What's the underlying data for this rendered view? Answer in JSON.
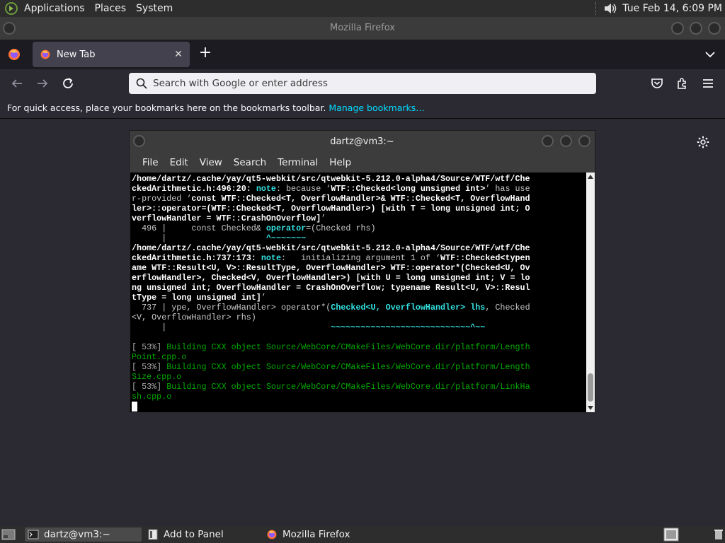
{
  "top_panel": {
    "menus": [
      "Applications",
      "Places",
      "System"
    ],
    "clock": "Tue Feb 14,  6:09 PM",
    "icons": {
      "logo": "gnome-foot-icon",
      "volume": "speaker-icon"
    }
  },
  "firefox": {
    "window_title": "Mozilla Firefox",
    "tab_label": "New Tab",
    "url_placeholder": "Search with Google or enter address",
    "bookmarks_message": "For quick access, place your bookmarks here on the bookmarks toolbar.",
    "bookmarks_link": "Manage bookmarks…",
    "colors": {
      "accent_link": "#00ddff",
      "background": "#2b2a33"
    }
  },
  "terminal": {
    "title": "dartz@vm3:~",
    "menus": [
      "File",
      "Edit",
      "View",
      "Search",
      "Terminal",
      "Help"
    ],
    "lines": [
      [
        [
          "w",
          "/home/dartz/.cache/yay/qt5-webkit/src/qtwebkit-5.212.0-alpha4/Source/WTF/wtf/Che"
        ]
      ],
      [
        [
          "w",
          "ckedArithmetic.h:496:20: "
        ],
        [
          "cy",
          "note"
        ],
        [
          "n",
          ": because ‘"
        ],
        [
          "w",
          "WTF::Checked<long unsigned int>"
        ],
        [
          "n",
          "’ has use"
        ]
      ],
      [
        [
          "n",
          "r-provided ‘"
        ],
        [
          "w",
          "const WTF::Checked<T, OverflowHandler>& WTF::Checked<T, OverflowHand"
        ]
      ],
      [
        [
          "w",
          "ler>::operator=(WTF::Checked<T, OverflowHandler>) [with T = long unsigned int; O"
        ]
      ],
      [
        [
          "w",
          "verflowHandler = WTF::CrashOnOverflow]"
        ],
        [
          "n",
          "’"
        ]
      ],
      [
        [
          "n",
          "  496 |     const Checked& "
        ],
        [
          "cy",
          "operator"
        ],
        [
          "n",
          "=(Checked rhs)"
        ]
      ],
      [
        [
          "n",
          "      |                    "
        ],
        [
          "ul",
          "^~~~~~~~"
        ]
      ],
      [
        [
          "w",
          "/home/dartz/.cache/yay/qt5-webkit/src/qtwebkit-5.212.0-alpha4/Source/WTF/wtf/Che"
        ]
      ],
      [
        [
          "w",
          "ckedArithmetic.h:737:173: "
        ],
        [
          "cy",
          "note"
        ],
        [
          "n",
          ":   initializing argument 1 of ‘"
        ],
        [
          "w",
          "WTF::Checked<typen"
        ]
      ],
      [
        [
          "w",
          "ame WTF::Result<U, V>::ResultType, OverflowHandler> WTF::operator*(Checked<U, Ov"
        ]
      ],
      [
        [
          "w",
          "erflowHandler>, Checked<V, OverflowHandler>) [with U = long unsigned int; V = lo"
        ]
      ],
      [
        [
          "w",
          "ng unsigned int; OverflowHandler = CrashOnOverflow; typename Result<U, V>::Resul"
        ]
      ],
      [
        [
          "w",
          "tType = long unsigned int]"
        ],
        [
          "n",
          "’"
        ]
      ],
      [
        [
          "n",
          "  737 | ype, OverflowHandler> operator*("
        ],
        [
          "cy",
          "Checked<U, OverflowHandler> lhs"
        ],
        [
          "n",
          ", Checked"
        ]
      ],
      [
        [
          "n",
          "<V, OverflowHandler> rhs)"
        ]
      ],
      [
        [
          "n",
          "      |                                 "
        ],
        [
          "ul",
          "~~~~~~~~~~~~~~~~~~~~~~~~~~~~^~~"
        ]
      ],
      [
        [
          "n",
          " "
        ]
      ],
      [
        [
          "gr",
          "[ 53%] "
        ],
        [
          "g",
          "Building CXX object Source/WebCore/CMakeFiles/WebCore.dir/platform/Length"
        ]
      ],
      [
        [
          "g",
          "Point.cpp.o"
        ]
      ],
      [
        [
          "gr",
          "[ 53%] "
        ],
        [
          "g",
          "Building CXX object Source/WebCore/CMakeFiles/WebCore.dir/platform/Length"
        ]
      ],
      [
        [
          "g",
          "Size.cpp.o"
        ]
      ],
      [
        [
          "gr",
          "[ 53%] "
        ],
        [
          "g",
          "Building CXX object Source/WebCore/CMakeFiles/WebCore.dir/platform/LinkHa"
        ]
      ],
      [
        [
          "g",
          "sh.cpp.o"
        ]
      ]
    ],
    "colors": {
      "text": "#c8c8c8",
      "highlight": "#34e2e2",
      "build": "#00aa00",
      "background": "#000000"
    }
  },
  "taskbar": {
    "items": [
      {
        "label": "dartz@vm3:~",
        "icon": "terminal-icon",
        "active": true
      },
      {
        "label": "Add to Panel",
        "icon": "panel-icon",
        "active": false
      },
      {
        "label": "Mozilla Firefox",
        "icon": "firefox-icon",
        "active": false
      }
    ]
  }
}
